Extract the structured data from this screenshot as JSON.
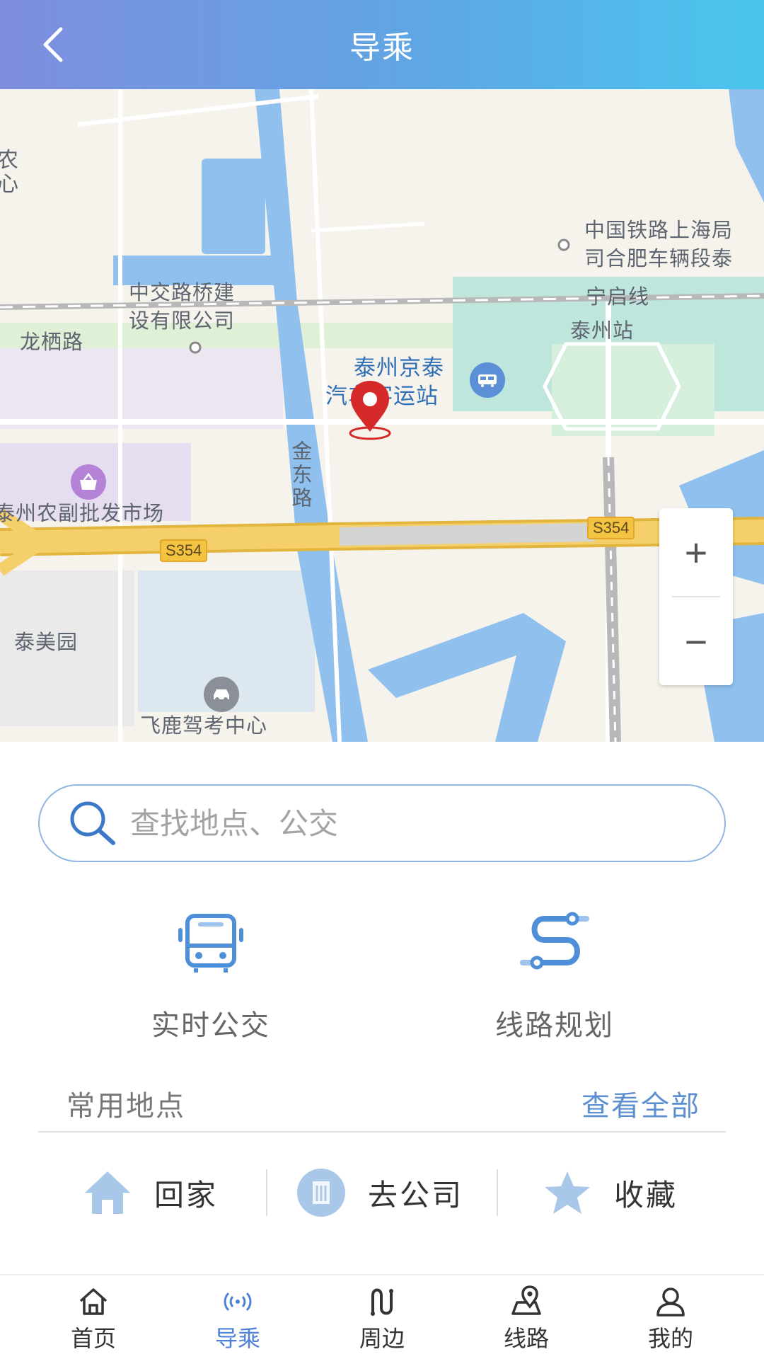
{
  "header": {
    "title": "导乘"
  },
  "map": {
    "labels": {
      "partial_left": "农\n心",
      "railway_office": "中国铁路上海局",
      "railway_office2": "司合肥车辆段泰",
      "company": "中交路桥建",
      "company2": "设有限公司",
      "longqi_road": "龙栖路",
      "ningqi_line": "宁启线",
      "taizhou_station": "泰州站",
      "bus_station": "泰州京泰",
      "bus_station2": "汽车客运站",
      "jindong_road": "金东路",
      "market": "泰州农副批发市场",
      "taimeiyuan": "泰美园",
      "driving_school": "飞鹿驾考中心",
      "road_s354_a": "S354",
      "road_s354_b": "S354"
    },
    "zoom_in": "+",
    "zoom_out": "−"
  },
  "search": {
    "placeholder": "查找地点、公交"
  },
  "actions": {
    "realtime_bus": "实时公交",
    "route_plan": "线路规划"
  },
  "frequent": {
    "title": "常用地点",
    "view_all": "查看全部",
    "home": "回家",
    "company": "去公司",
    "favorites": "收藏"
  },
  "tabs": {
    "home": "首页",
    "guide": "导乘",
    "nearby": "周边",
    "routes": "线路",
    "mine": "我的"
  },
  "colors": {
    "header_start": "#7f8ede",
    "header_end": "#4ac6ee",
    "active_tab": "#4f7fd6",
    "link": "#5b8fd0"
  }
}
